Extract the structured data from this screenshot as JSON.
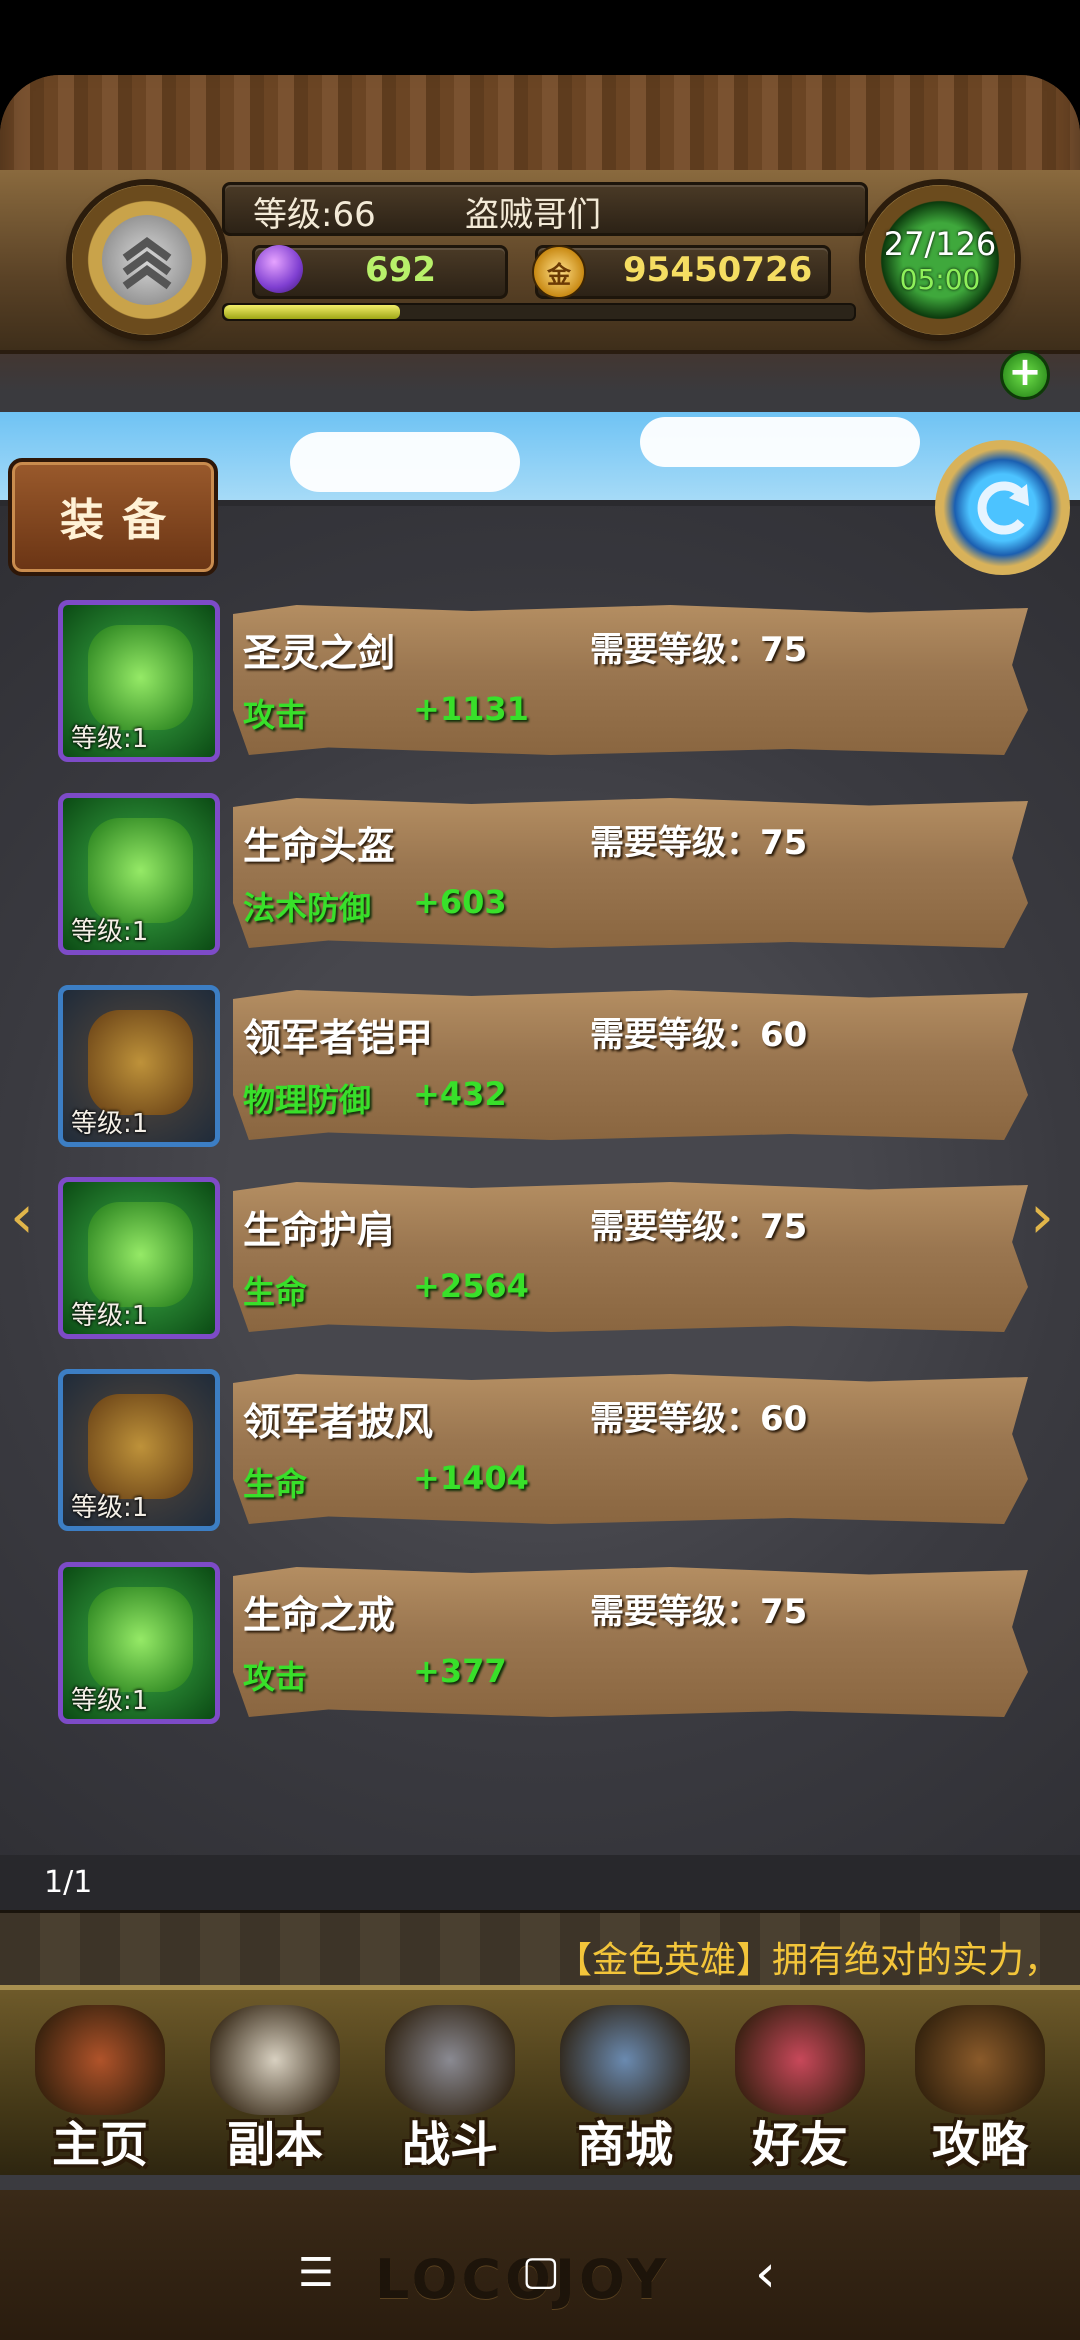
{
  "header": {
    "level_text": "等级:66",
    "player_name": "盗贼哥们",
    "gems": "692",
    "gold": "95450726",
    "gold_icon_text": "金",
    "energy": "27/126",
    "timer": "05:00",
    "add_energy_label": "+",
    "exp_progress": 0.28
  },
  "tab": {
    "label": "装备"
  },
  "equipment": [
    {
      "name": "圣灵之剑",
      "required": "需要等级：75",
      "stat": "攻击",
      "value": "+1131",
      "item_level": "等级:1",
      "rarity": "purple",
      "color": "#3fb24a"
    },
    {
      "name": "生命头盔",
      "required": "需要等级：75",
      "stat": "法术防御",
      "value": "+603",
      "item_level": "等级:1",
      "rarity": "purple",
      "color": "#3fb24a"
    },
    {
      "name": "领军者铠甲",
      "required": "需要等级：60",
      "stat": "物理防御",
      "value": "+432",
      "item_level": "等级:1",
      "rarity": "blue",
      "color": "#b8862c"
    },
    {
      "name": "生命护肩",
      "required": "需要等级：75",
      "stat": "生命",
      "value": "+2564",
      "item_level": "等级:1",
      "rarity": "purple",
      "color": "#3fb24a"
    },
    {
      "name": "领军者披风",
      "required": "需要等级：60",
      "stat": "生命",
      "value": "+1404",
      "item_level": "等级:1",
      "rarity": "blue",
      "color": "#b8862c"
    },
    {
      "name": "生命之戒",
      "required": "需要等级：75",
      "stat": "攻击",
      "value": "+377",
      "item_level": "等级:1",
      "rarity": "purple",
      "color": "#3fb24a"
    }
  ],
  "arrows": {
    "left": "‹",
    "right": "›"
  },
  "pagination": "1/1",
  "ticker": "【金色英雄】拥有绝对的实力，",
  "nav": [
    {
      "label": "主页",
      "icon": "house-icon"
    },
    {
      "label": "副本",
      "icon": "skull-icon"
    },
    {
      "label": "战斗",
      "icon": "sword-icon"
    },
    {
      "label": "商城",
      "icon": "shop-icon"
    },
    {
      "label": "好友",
      "icon": "friends-icon"
    },
    {
      "label": "攻略",
      "icon": "book-icon"
    }
  ],
  "system_bar": {
    "menu": "☰",
    "home": "▢",
    "back": "‹",
    "logo": "LOCOJOY"
  }
}
